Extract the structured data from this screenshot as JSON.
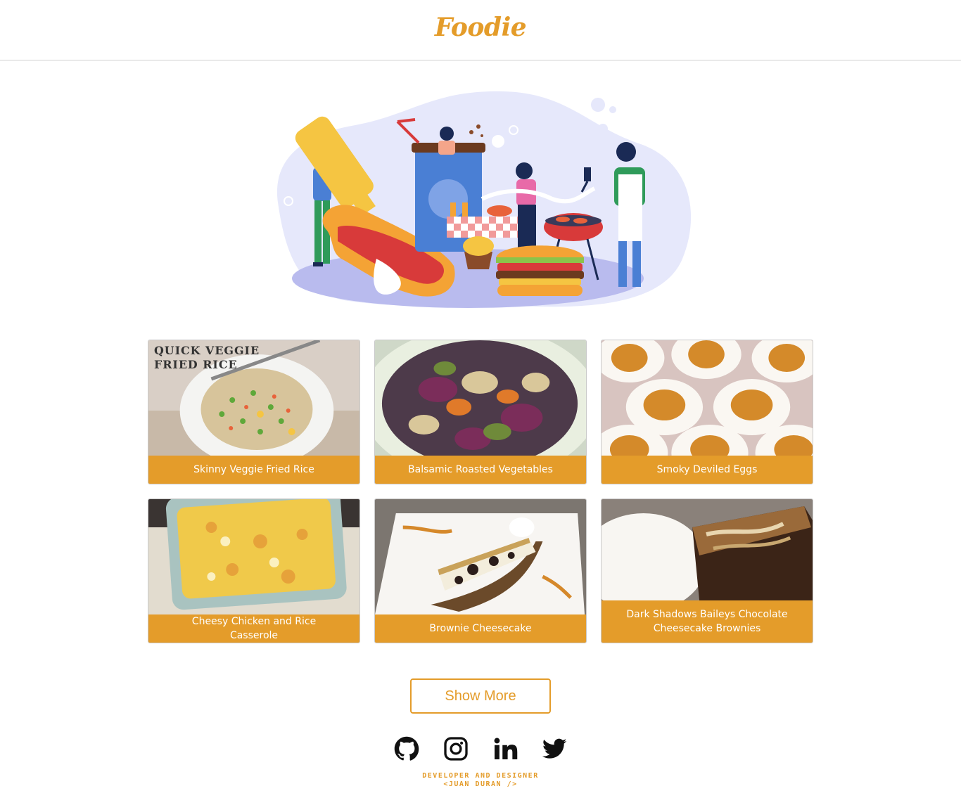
{
  "brand": {
    "name": "Foodie",
    "accent": "#e49c2a"
  },
  "recipes": [
    {
      "title": "Skinny Veggie Fried Rice",
      "overlay": "QUICK VEGGIE FRIED RICE"
    },
    {
      "title": "Balsamic Roasted Vegetables"
    },
    {
      "title": "Smoky Deviled Eggs"
    },
    {
      "title": "Cheesy Chicken and Rice Casserole"
    },
    {
      "title": "Brownie Cheesecake"
    },
    {
      "title": "Dark Shadows Baileys Chocolate Cheesecake Brownies"
    }
  ],
  "show_more_label": "Show More",
  "footer": {
    "social": [
      "github-icon",
      "instagram-icon",
      "linkedin-icon",
      "twitter-icon"
    ],
    "credit_line1": "DEVELOPER AND DESIGNER",
    "credit_line2": "<JUAN DURAN />"
  }
}
